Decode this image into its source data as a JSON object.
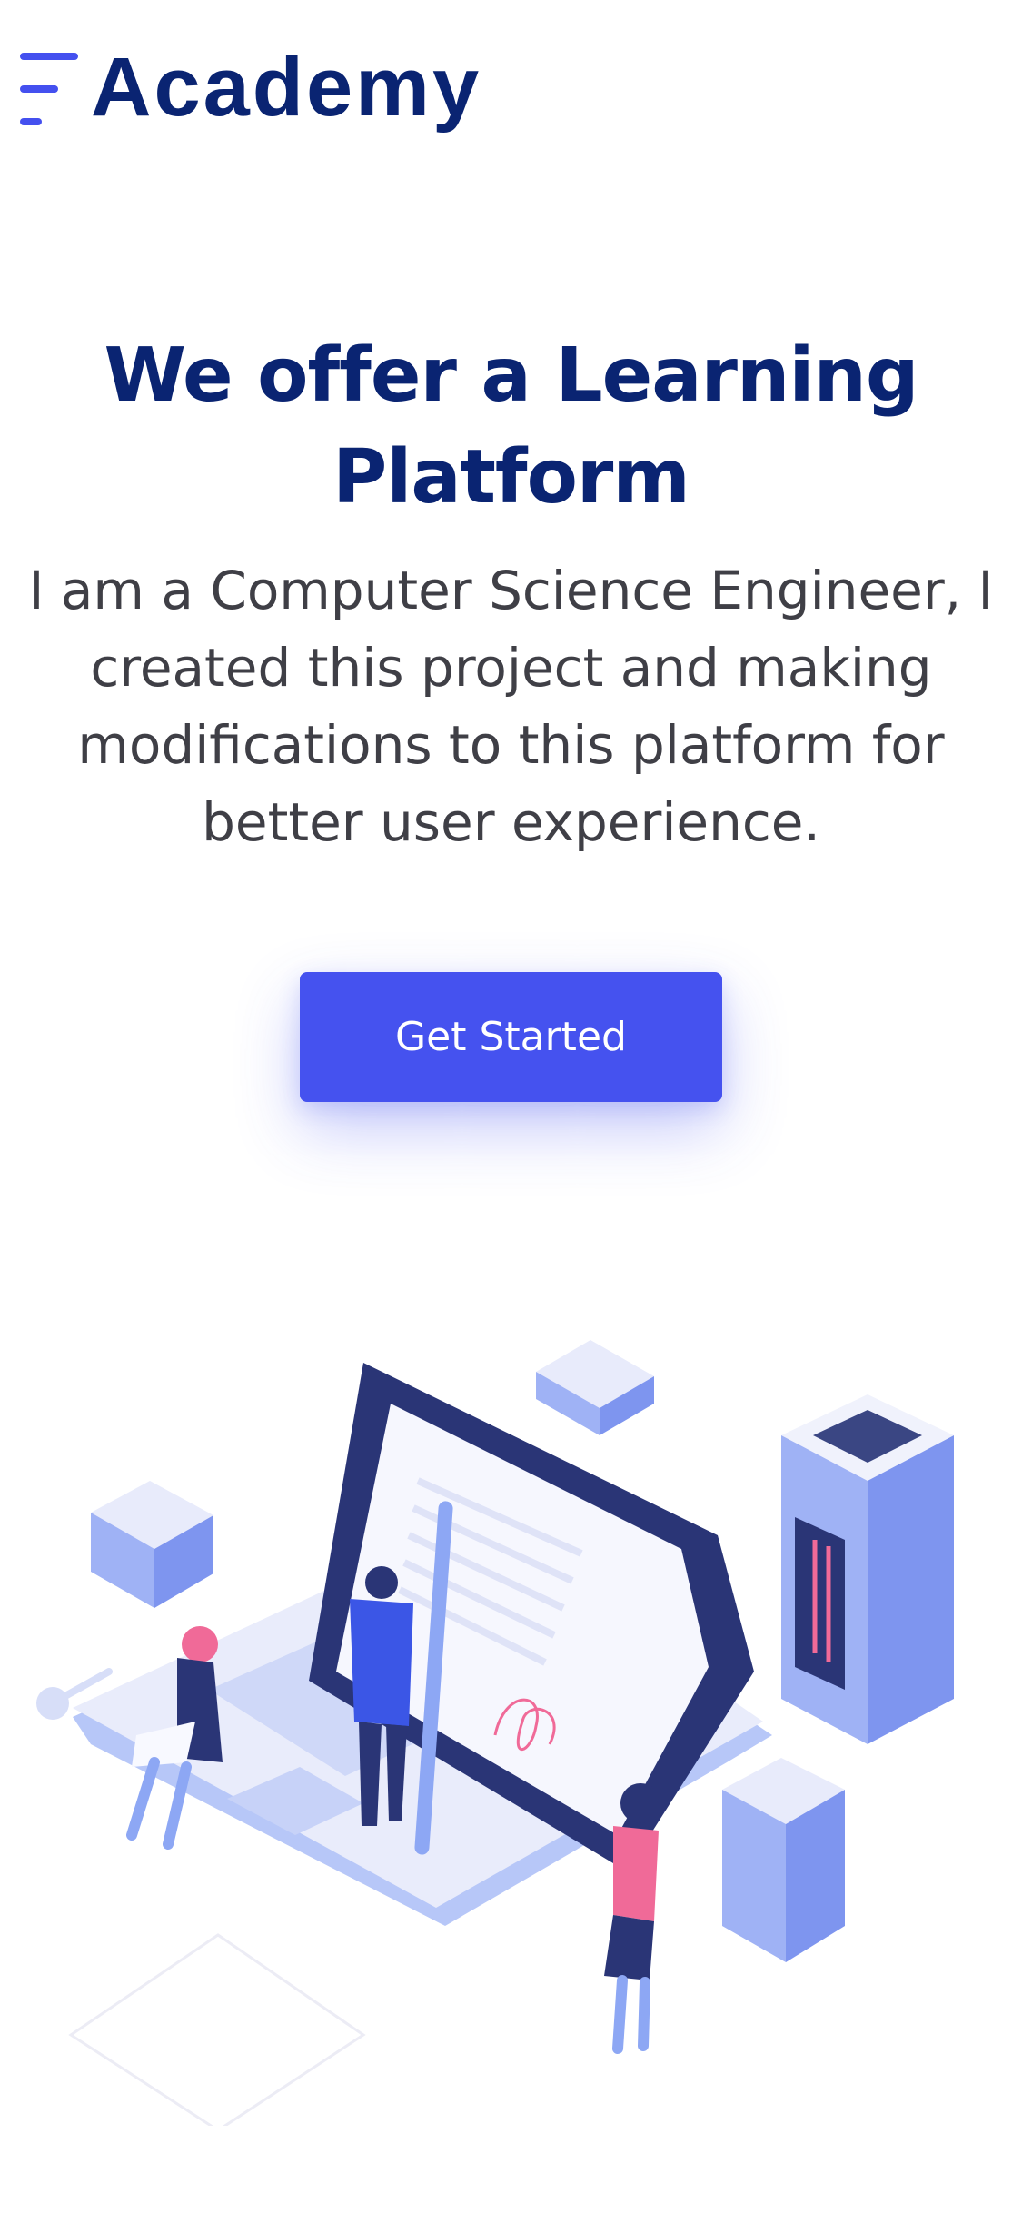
{
  "header": {
    "brand": "Academy",
    "menu_icon": "menu-icon"
  },
  "hero": {
    "title": "We offer a Learning Platform",
    "text": "I am a Computer Science Engineer, I created this project and making modifications to this platform for better user experience.",
    "cta_label": "Get Started"
  },
  "illustration": {
    "icon": "learning-platform-illustration"
  },
  "colors": {
    "accent": "#4552ef",
    "heading": "#0a2472",
    "body_text": "#3f3f46"
  }
}
